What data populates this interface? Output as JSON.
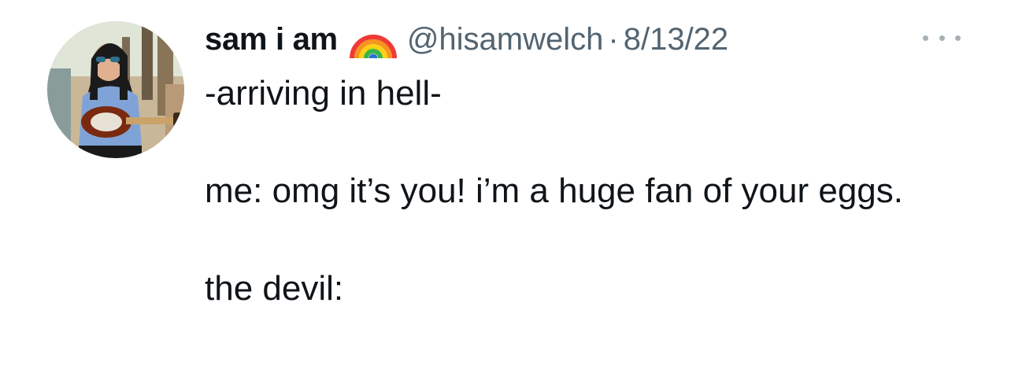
{
  "tweet": {
    "display_name": "sam i am",
    "name_emoji": "rainbow-emoji",
    "handle": "@hisamwelch",
    "separator": "·",
    "date": "8/13/22",
    "more_icon": "more-horizontal-icon",
    "text": "-arriving in hell-\n\nme: omg it’s you! i’m a huge fan of your eggs.\n\nthe devil:",
    "avatar_icon": "avatar-photo"
  },
  "colors": {
    "primary_text": "#0f1419",
    "secondary_text": "#536471",
    "background": "#ffffff"
  }
}
